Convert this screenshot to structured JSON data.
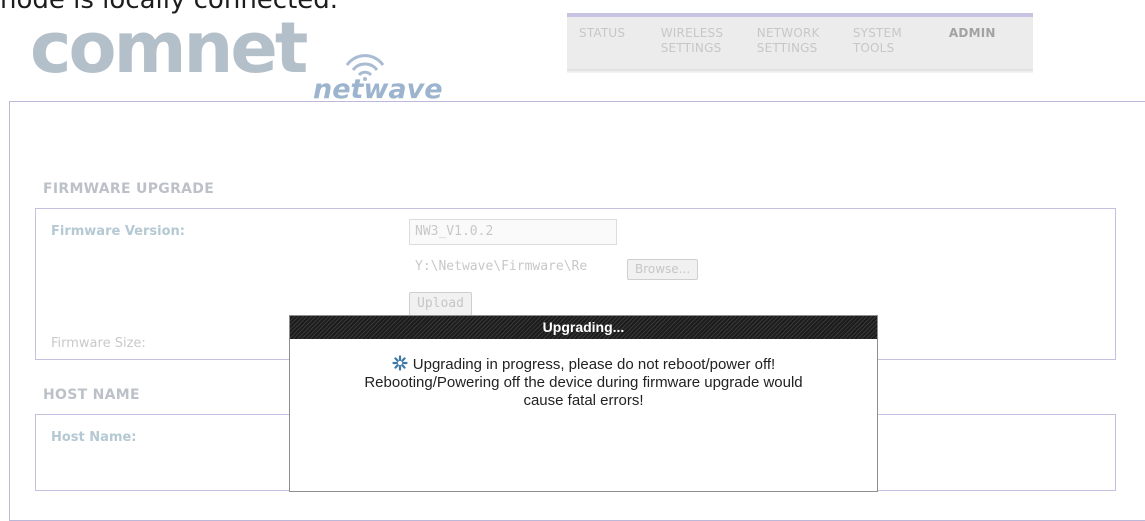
{
  "caption_fragment": "node is locally connected.",
  "brand": {
    "logo_main": "comnet",
    "logo_sub": "netwave",
    "colors": {
      "logo_grey": "#b3bfc9",
      "logo_blue": "#9db4cf",
      "nav_accent": "#c7c3e2"
    }
  },
  "nav": {
    "tabs": [
      {
        "line1": "STATUS",
        "line2": ""
      },
      {
        "line1": "WIRELESS",
        "line2": "SETTINGS"
      },
      {
        "line1": "NETWORK",
        "line2": "SETTINGS"
      },
      {
        "line1": "SYSTEM",
        "line2": "TOOLS"
      },
      {
        "line1": "ADMIN",
        "line2": ""
      }
    ],
    "active": "ADMIN"
  },
  "firmware": {
    "title": "FIRMWARE UPGRADE",
    "version_label": "Firmware Version:",
    "version_value": "NW3_V1.0.2",
    "file_path": "Y:\\Netwave\\Firmware\\Re",
    "browse_label": "Browse...",
    "upload_label": "Upload",
    "size_label": "Firmware Size:"
  },
  "host": {
    "title": "HOST NAME",
    "name_label": "Host Name:"
  },
  "modal": {
    "title": "Upgrading...",
    "line1": "Upgrading in progress, please do not reboot/power off!",
    "line2": "Rebooting/Powering off the device during firmware upgrade would",
    "line3": "cause fatal errors!",
    "icon": "spinner-icon"
  }
}
